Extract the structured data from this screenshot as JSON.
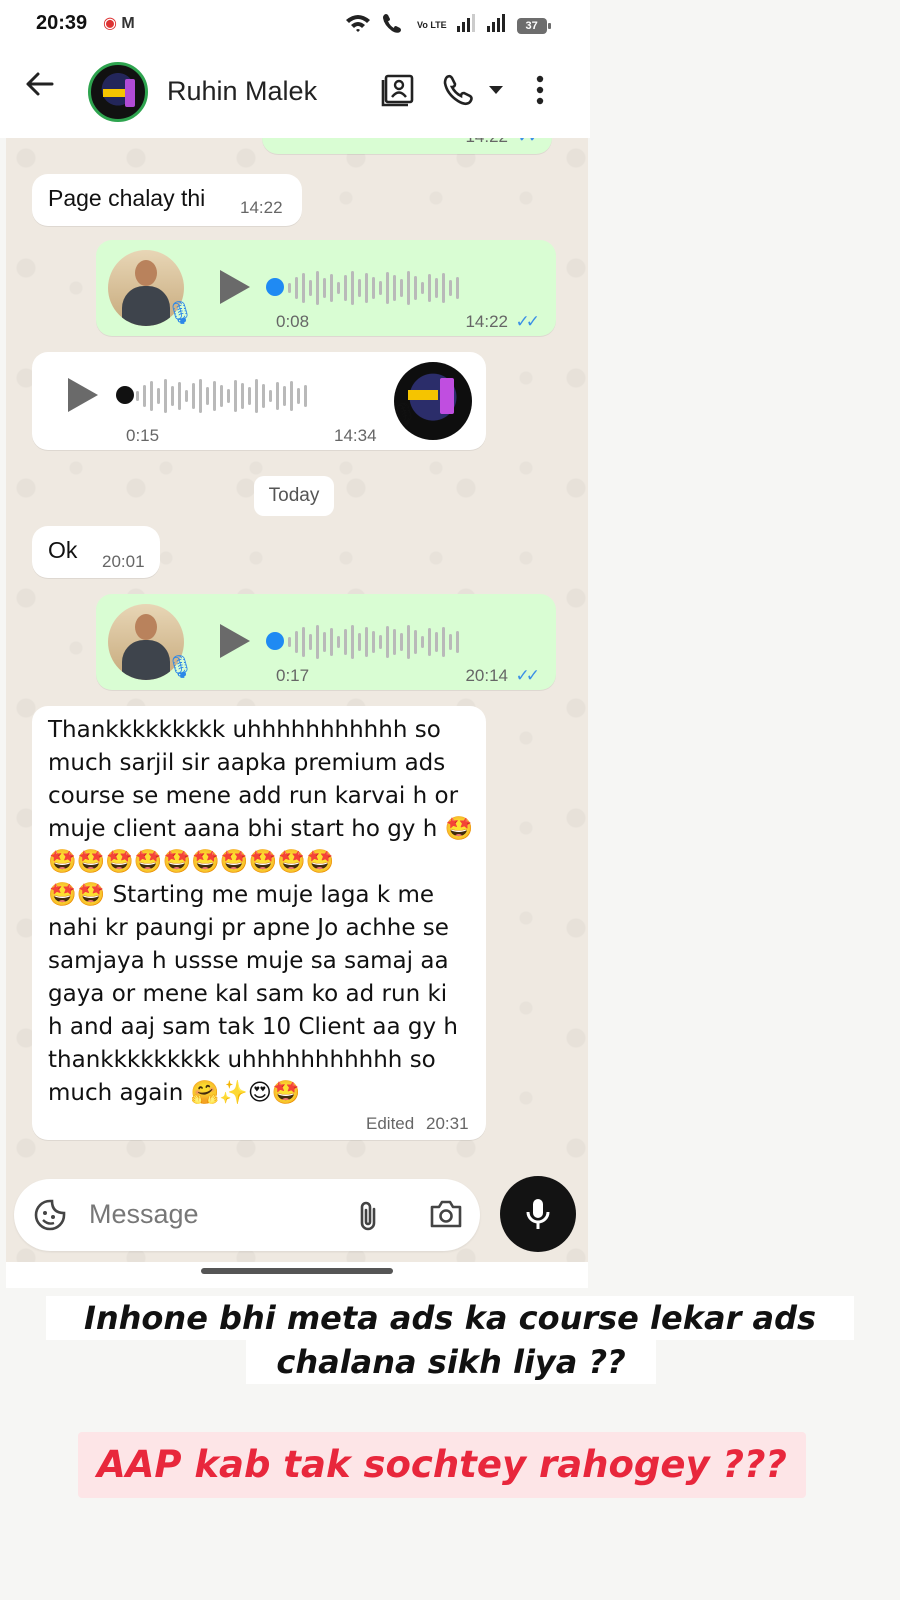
{
  "status_bar": {
    "time": "20:39",
    "left_icons": "M",
    "network": "Vo LTE",
    "battery": "37"
  },
  "header": {
    "contact_name": "Ruhin Malek"
  },
  "messages": {
    "m0": {
      "time": "14:22"
    },
    "m1": {
      "text": "Page chalay thi",
      "time": "14:22"
    },
    "m2": {
      "duration": "0:08",
      "time": "14:22"
    },
    "m3": {
      "duration": "0:15",
      "time": "14:34"
    },
    "day_divider": "Today",
    "m4": {
      "text": "Ok",
      "time": "20:01"
    },
    "m5": {
      "duration": "0:17",
      "time": "20:14"
    },
    "m6": {
      "lines": [
        "Thankkkkkkkkk uhhhhhhhhhhh so",
        "much sarjil sir aapka premium ads",
        "course se mene add run karvai h or",
        "muje client aana bhi start ho gy h 🤩",
        "🤩🤩🤩🤩🤩🤩🤩🤩🤩🤩",
        "🤩🤩 Starting me muje laga k me",
        "nahi kr paungi pr apne Jo achhe se",
        "samjaya h ussse muje sa samaj aa",
        "gaya or mene kal sam ko ad run ki",
        "h and aaj sam tak 10 Client aa gy h",
        "thankkkkkkkkk uhhhhhhhhhhh so",
        "much again 🤗✨😍🤩"
      ],
      "edited_label": "Edited",
      "time": "20:31"
    }
  },
  "input": {
    "placeholder": "Message"
  },
  "captions": {
    "line1": "Inhone bhi meta ads ka course lekar ads",
    "line2": "chalana sikh liya ??",
    "line3": "AAP kab  tak sochtey rahogey ???"
  },
  "icons": [
    "back-arrow-icon",
    "contact-card-icon",
    "phone-icon",
    "dropdown-icon",
    "more-icon",
    "play-icon",
    "mic-icon",
    "sticker-icon",
    "attach-icon",
    "camera-icon",
    "read-ticks-icon"
  ],
  "colors": {
    "outgoing_bubble": "#d9fdd3",
    "incoming_bubble": "#ffffff",
    "tick_blue": "#3b8fe6",
    "caption_red": "#e8273c",
    "caption_red_bg": "#fde5e7"
  }
}
